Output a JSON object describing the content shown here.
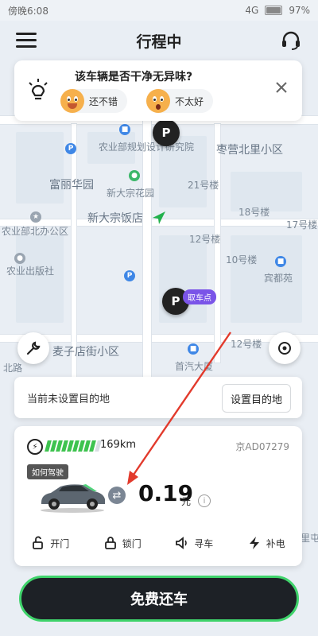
{
  "status_bar": {
    "time": "傍晚6:08",
    "network": "4G",
    "battery": "97%"
  },
  "header": {
    "title": "行程中"
  },
  "feedback": {
    "question": "该车辆是否干净无异味?",
    "option_good": "还不错",
    "option_bad": "不太好"
  },
  "map": {
    "labels": [
      "农业部规划设计研究院",
      "富丽华园",
      "新大宗花园",
      "新大宗饭店",
      "农业部北办公区",
      "农业出版社",
      "麦子店街小区",
      "首汽大厦",
      "宾都苑",
      "枣营北里小区",
      "21号楼",
      "18号楼",
      "17号楼",
      "12号楼",
      "10号楼",
      "12号楼",
      "北路",
      "三里屯"
    ],
    "pickup_tag": "取车点",
    "parking_glyph": "P"
  },
  "destination": {
    "status_text": "当前未设置目的地",
    "set_button": "设置目的地"
  },
  "vehicle": {
    "battery_level": 0.9,
    "range": "169km",
    "plate": "京AD07279",
    "how_to_drive": "如何驾驶",
    "price": "0.19",
    "price_unit": "元",
    "actions": {
      "open": "开门",
      "lock": "锁门",
      "find": "寻车",
      "charge": "补电"
    }
  },
  "return_button": "免费还车",
  "colors": {
    "accent_green": "#3ec34f",
    "button_dark": "#1d2126",
    "pickup_purple": "#7a54e8",
    "annotation_red": "#e23a2c"
  }
}
